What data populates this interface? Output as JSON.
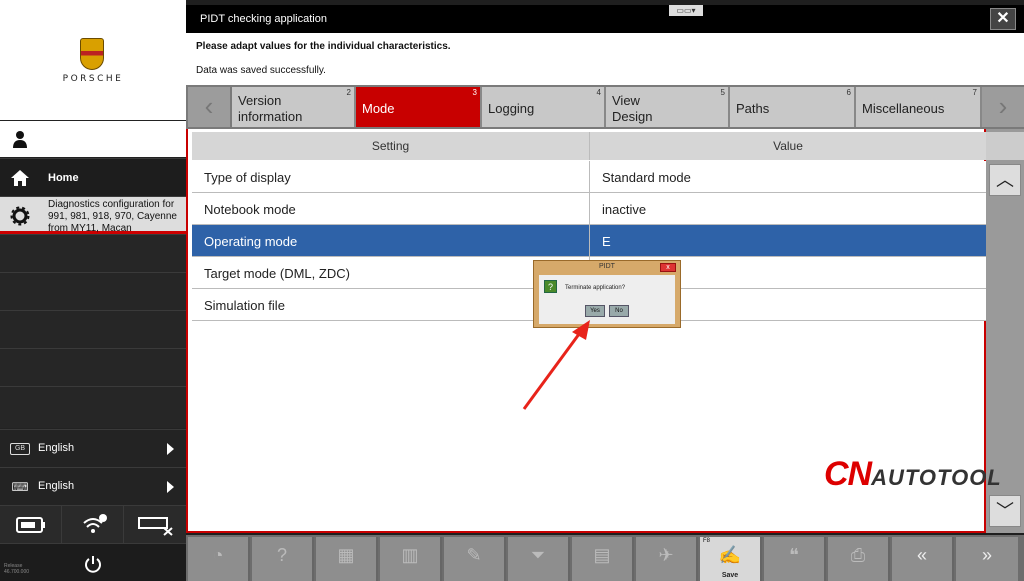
{
  "sidebar": {
    "brand": "PORSCHE",
    "home_label": "Home",
    "diagnostics_label": "Diagnostics configuration for 991, 981, 918, 970, Cayenne from MY11, Macan",
    "languages": [
      {
        "badge": "GB",
        "label": "English"
      },
      {
        "badge": "⌨",
        "label": "English"
      }
    ],
    "release": "Release\n46.700.000"
  },
  "window": {
    "title": "PIDT checking application",
    "message_instruction": "Please adapt values for the individual characteristics.",
    "message_status": "Data was saved successfully."
  },
  "tabs": [
    {
      "label": "Version information",
      "number": "2"
    },
    {
      "label": "Mode",
      "number": "3",
      "active": true
    },
    {
      "label": "Logging",
      "number": "4"
    },
    {
      "label": "View Design",
      "number": "5"
    },
    {
      "label": "Paths",
      "number": "6"
    },
    {
      "label": "Miscellaneous",
      "number": "7"
    }
  ],
  "table": {
    "headers": [
      "Setting",
      "Value"
    ],
    "rows": [
      {
        "setting": "Type of display",
        "value": "Standard mode"
      },
      {
        "setting": "Notebook mode",
        "value": "inactive"
      },
      {
        "setting": "Operating mode",
        "value": "E",
        "selected": true
      },
      {
        "setting": "Target mode (DML, ZDC)",
        "value": ""
      },
      {
        "setting": "Simulation file",
        "value": ""
      }
    ]
  },
  "dialog": {
    "title": "PIDT",
    "message": "Terminate application?",
    "yes_label": "Yes",
    "no_label": "No",
    "close_label": "x"
  },
  "watermark": {
    "prefix": "CN",
    "rest": "AUTOTOOL"
  },
  "toolbar": {
    "save_key": "F8",
    "save_label": "Save"
  },
  "colors": {
    "accent": "#c80000",
    "selection": "#2e62a8"
  }
}
